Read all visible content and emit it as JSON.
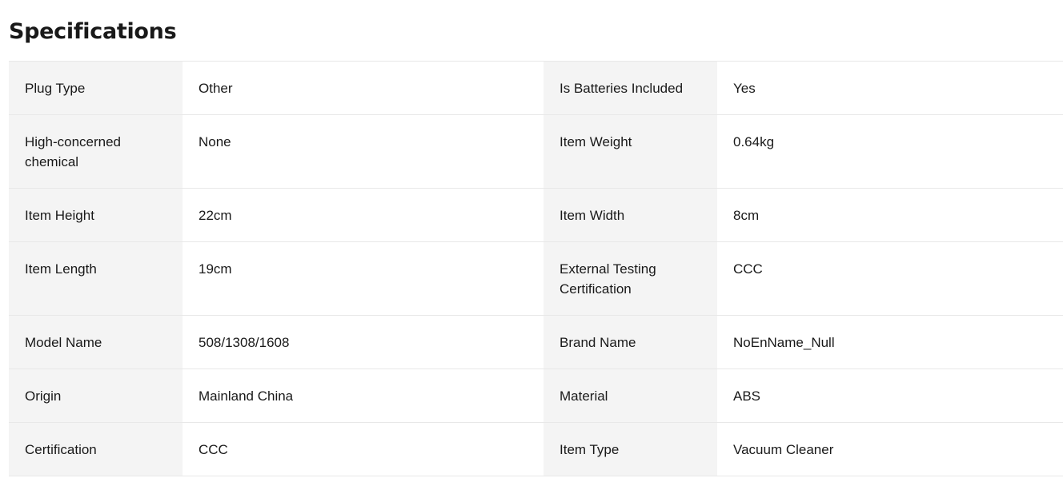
{
  "title": "Specifications",
  "rows": [
    {
      "k1": "Plug Type",
      "v1": "Other",
      "k2": "Is Batteries Included",
      "v2": "Yes"
    },
    {
      "k1": "High-concerned chemical",
      "v1": "None",
      "k2": "Item Weight",
      "v2": "0.64kg"
    },
    {
      "k1": "Item Height",
      "v1": "22cm",
      "k2": "Item Width",
      "v2": "8cm"
    },
    {
      "k1": "Item Length",
      "v1": "19cm",
      "k2": "External Testing Certification",
      "v2": "CCC"
    },
    {
      "k1": "Model Name",
      "v1": "508/1308/1608",
      "k2": "Brand Name",
      "v2": "NoEnName_Null"
    },
    {
      "k1": "Origin",
      "v1": "Mainland China",
      "k2": "Material",
      "v2": "ABS"
    },
    {
      "k1": "Certification",
      "v1": "CCC",
      "k2": "Item Type",
      "v2": "Vacuum Cleaner"
    }
  ]
}
